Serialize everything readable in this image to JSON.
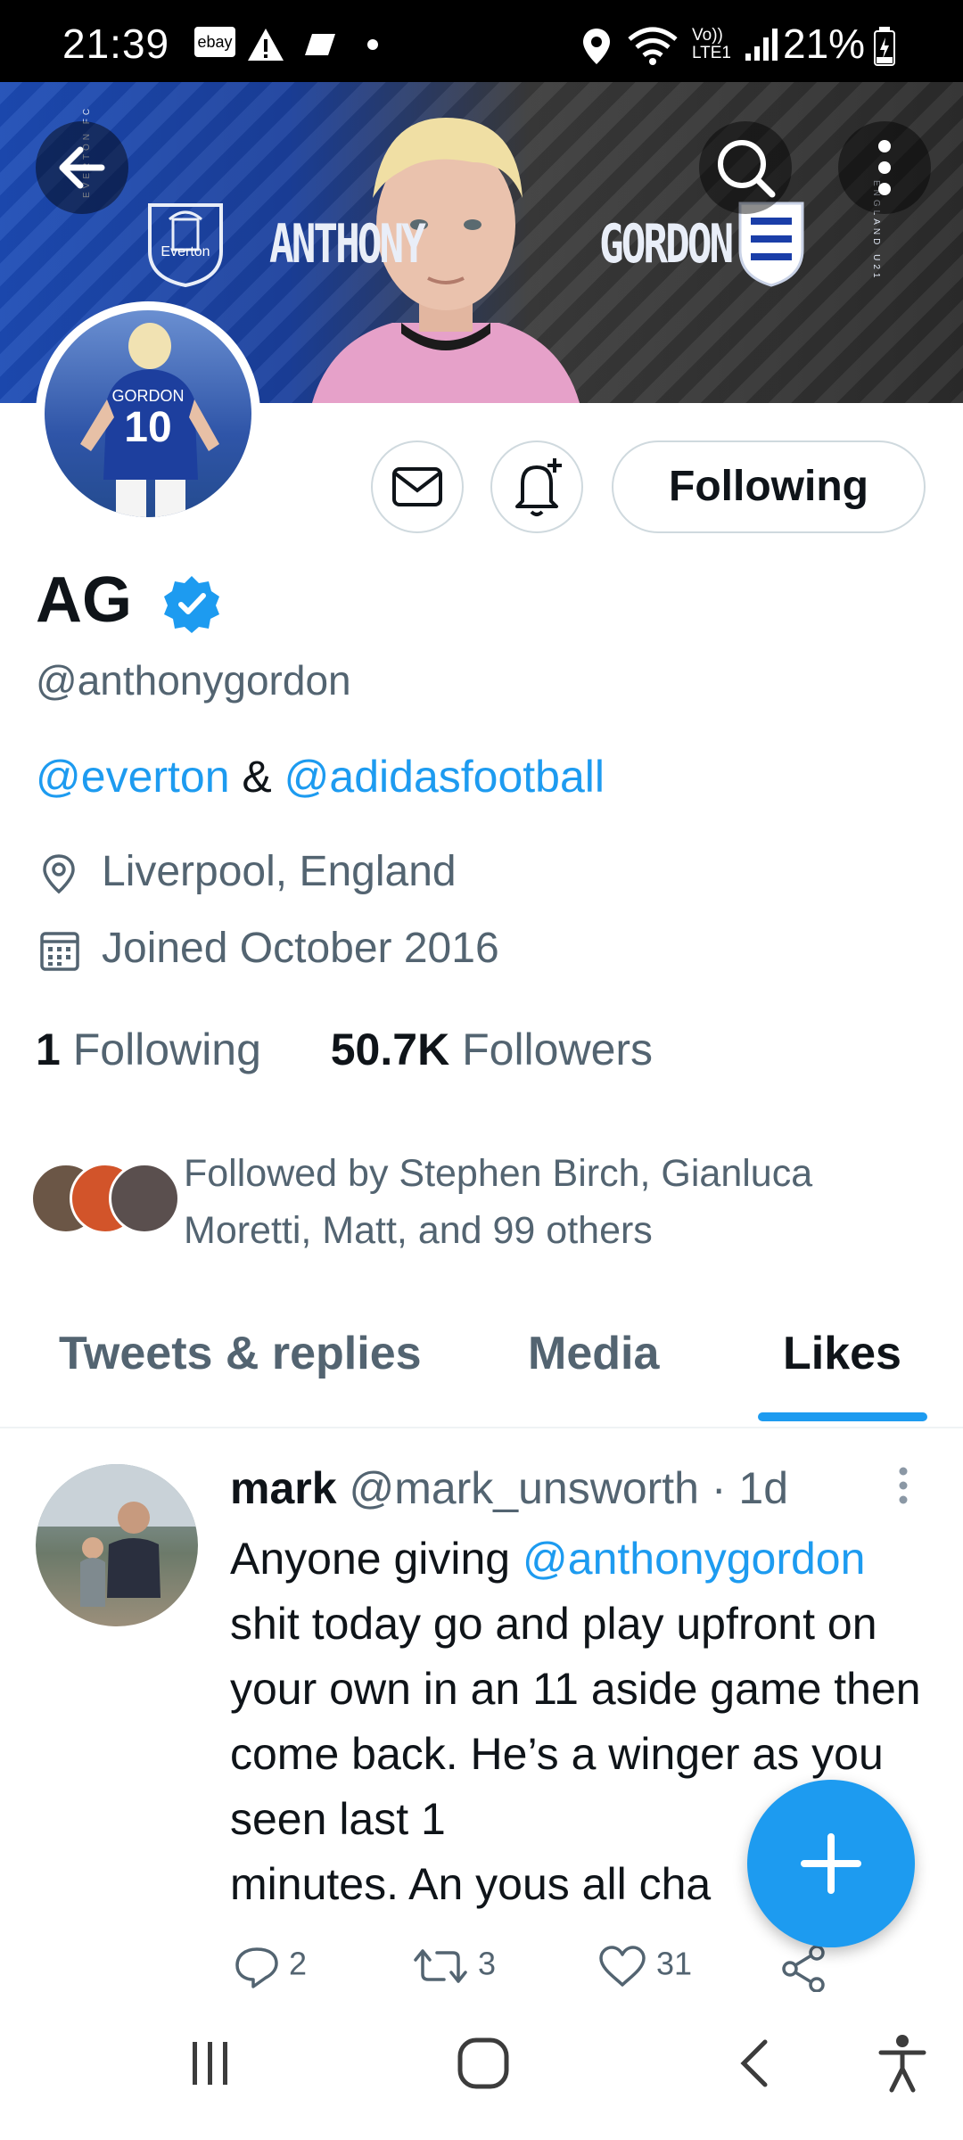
{
  "status_bar": {
    "time": "21:39",
    "ebay_label": "ebay",
    "network_label": "Vo)) LTE1",
    "battery": "21%"
  },
  "banner": {
    "name_left": "ANTHONY",
    "name_right": "GORDON",
    "club_badge": "Everton",
    "side_left": "EVERTON FC",
    "side_right": "ENGLAND U21",
    "back_icon": "back-arrow-icon",
    "search_icon": "search-icon",
    "more_icon": "more-vertical-icon"
  },
  "avatar": {
    "shirt_name": "GORDON",
    "shirt_number": "10"
  },
  "profile": {
    "display_name": "AG",
    "handle": "@anthonygordon",
    "bio_link1": "@everton",
    "bio_amp": " & ",
    "bio_link2": "@adidasfootball",
    "location": "Liverpool, England",
    "joined": "Joined October 2016",
    "following_count": "1",
    "following_label": "Following",
    "followers_count": "50.7K",
    "followers_label": "Followers",
    "followed_by": "Followed by Stephen Birch, Gianluca Moretti, Matt, and 99 others",
    "following_button": "Following"
  },
  "tabs": [
    {
      "label": "Tweets & replies"
    },
    {
      "label": "Media"
    },
    {
      "label": "Likes"
    }
  ],
  "tweet": {
    "name": "mark",
    "handle": "@mark_unsworth",
    "time": " · 1d",
    "text_part1": "Anyone giving ",
    "text_mention": "@anthonygordon",
    "text_part2": " shit today go and play upfront on your own in an 11 aside game then come back. He’s a winger as you seen last 1",
    "text_part3": "minutes. An yous all cha",
    "replies": "2",
    "retweets": "3",
    "likes": "31"
  },
  "colors": {
    "accent": "#1d9bf0",
    "text_primary": "#0f1419",
    "text_secondary": "#536471"
  }
}
